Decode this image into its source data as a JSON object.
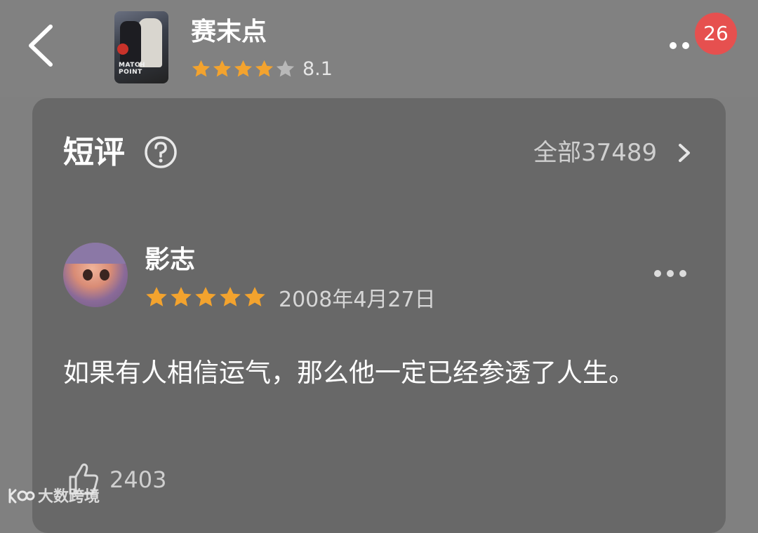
{
  "header": {
    "movie_title": "赛末点",
    "rating_value": "8.1",
    "rating_stars": 4,
    "poster_title": "MATCH POINT",
    "notification_count": "26"
  },
  "comments": {
    "section_title": "短评",
    "all_link": "全部37489"
  },
  "review": {
    "username": "影志",
    "stars": 5,
    "date": "2008年4月27日",
    "text": "如果有人相信运气，那么他一定已经参透了人生。",
    "like_count": "2403"
  },
  "watermark": {
    "text": "大数跨境"
  },
  "colors": {
    "star_filled": "#f3a32e",
    "star_empty": "#b8b8b8",
    "badge": "#e6504f",
    "background": "#808080",
    "card": "#686868"
  },
  "icons": [
    "back-arrow-icon",
    "star-icon",
    "more-dots-icon",
    "question-circle-icon",
    "chevron-right-icon",
    "thumbs-up-icon"
  ]
}
